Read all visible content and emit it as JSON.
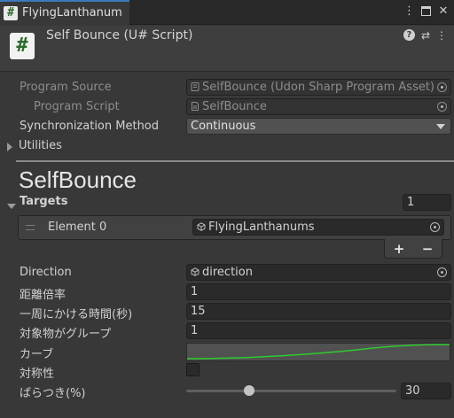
{
  "window": {
    "tab_title": "FlyingLanthanum",
    "tab_icon_glyph": "#",
    "menu_glyph": "⋮",
    "close_glyph": "✕"
  },
  "header": {
    "icon_glyph": "#",
    "title": "Self Bounce (U# Script)",
    "help_glyph": "?",
    "settings_glyph": "⇄",
    "menu_glyph": "⋮"
  },
  "program": {
    "program_source_label": "Program Source",
    "program_source_value": "SelfBounce (Udon Sharp Program Asset)",
    "program_script_label": "Program Script",
    "program_script_value": "SelfBounce",
    "sync_label": "Synchronization Method",
    "sync_value": "Continuous",
    "utilities_label": "Utilities"
  },
  "section_title": "SelfBounce",
  "targets": {
    "label": "Targets",
    "count": "1",
    "element_label": "Element 0",
    "element_value": "FlyingLanthanums",
    "add_glyph": "+",
    "remove_glyph": "−"
  },
  "fields": {
    "direction_label": "Direction",
    "direction_value": "direction",
    "distance_label": "距離倍率",
    "distance_value": "1",
    "period_label": "一周にかける時間(秒)",
    "period_value": "15",
    "group_label": "対象物がグループ",
    "group_value": "1",
    "curve_label": "カーブ",
    "symmetry_label": "対称性",
    "symmetry_checked": false,
    "variance_label": "ばらつき(%)",
    "variance_value": "30",
    "variance_fraction": 0.3
  },
  "colors": {
    "background": "#383838",
    "curve_line": "#2ecc2e",
    "tab_accent": "#3a79bb"
  },
  "icons": {
    "tab": "csharp-script-icon",
    "asset": "asset-icon",
    "script": "script-file-icon",
    "gameobject": "cube-icon",
    "target": "object-picker-icon"
  }
}
